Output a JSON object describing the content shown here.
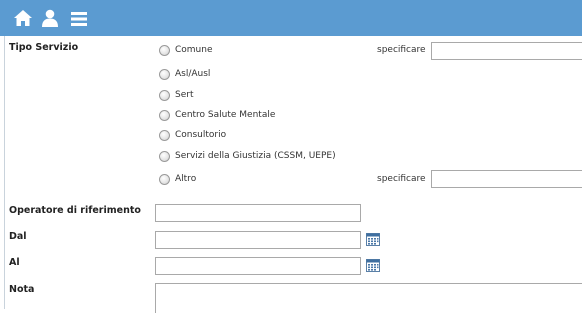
{
  "toolbar": {
    "icons": [
      "home-icon",
      "user-icon",
      "menu-icon"
    ],
    "color": "#5b9bd1"
  },
  "form": {
    "tipo_servizio": {
      "label": "Tipo Servizio",
      "options": [
        "Comune",
        "Asl/Ausl",
        "Sert",
        "Centro Salute Mentale",
        "Consultorio",
        "Servizi della Giustizia (CSSM, UEPE)",
        "Altro"
      ],
      "specificare_label": "specificare",
      "specificare_comune_value": "",
      "specificare_altro_value": ""
    },
    "operatore": {
      "label": "Operatore di riferimento",
      "value": ""
    },
    "dal": {
      "label": "Dal",
      "value": ""
    },
    "al": {
      "label": "Al",
      "value": ""
    },
    "nota": {
      "label": "Nota",
      "value": ""
    }
  }
}
